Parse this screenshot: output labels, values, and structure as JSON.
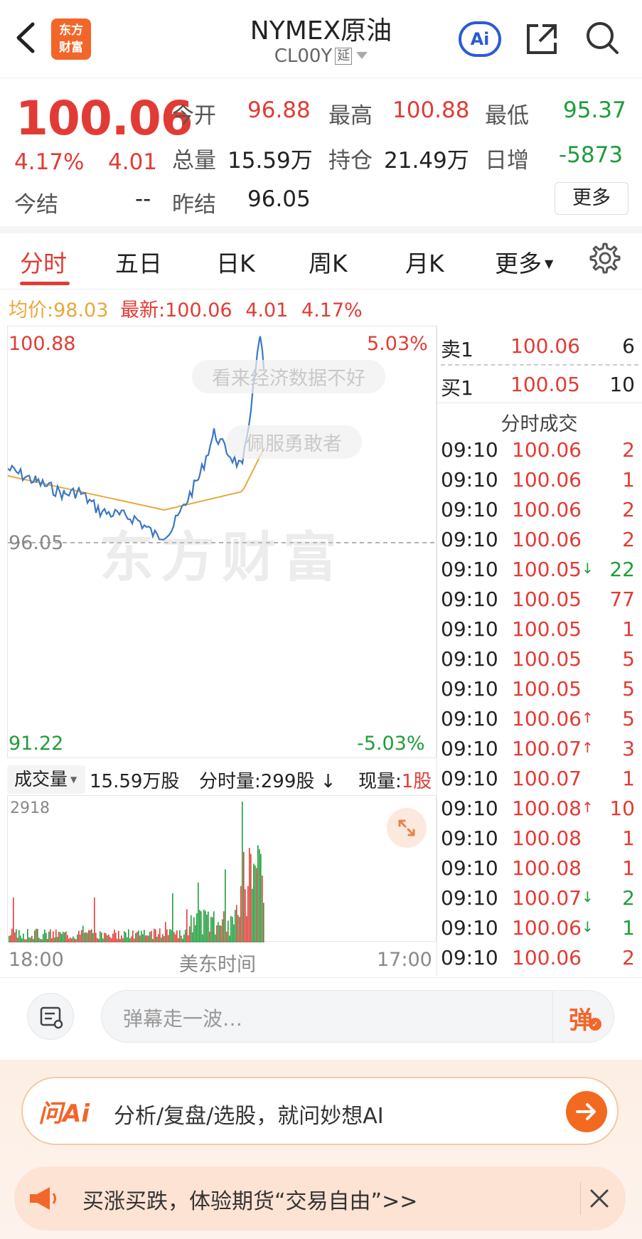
{
  "header": {
    "logo_text": "东方财富",
    "title": "NYMEX原油",
    "code": "CL00Y",
    "delay_tag": "延",
    "ai_label": "Ai"
  },
  "quote": {
    "price": "100.06",
    "change_pct": "4.17%",
    "change": "4.01",
    "open_label": "今开",
    "open": "96.88",
    "high_label": "最高",
    "high": "100.88",
    "low_label": "最低",
    "low": "95.37",
    "volume_label": "总量",
    "volume": "15.59万",
    "oi_label": "持仓",
    "oi": "21.49万",
    "daily_inc_label": "日增",
    "daily_inc": "-5873",
    "settle_label": "今结",
    "settle": "--",
    "prev_settle_label": "昨结",
    "prev_settle": "96.05",
    "more_label": "更多"
  },
  "tabs": [
    "分时",
    "五日",
    "日K",
    "周K",
    "月K",
    "更多"
  ],
  "chart_info": {
    "avg_label": "均价:",
    "avg": "98.03",
    "latest_label": "最新:",
    "latest": "100.06",
    "latest_chg": "4.01",
    "latest_pct": "4.17%"
  },
  "chart_axis": {
    "top_price": "100.88",
    "top_pct": "5.03%",
    "mid_price": "96.05",
    "bottom_price": "91.22",
    "bottom_pct": "-5.03%"
  },
  "watermarks": {
    "bullet1": "看来经济数据不好",
    "bullet2": "佩服勇敢者",
    "brand": "东方财富"
  },
  "volume_bar": {
    "label": "成交量",
    "total": "15.59万股",
    "tick_label": "分时量:",
    "tick": "299股",
    "now_label": "现量:",
    "now": "1股",
    "max": "2918",
    "start_time": "18:00",
    "tz_label": "美东时间",
    "end_time": "17:00"
  },
  "orderbook": [
    {
      "side": "卖1",
      "price": "100.06",
      "qty": "6"
    },
    {
      "side": "买1",
      "price": "100.05",
      "qty": "10"
    }
  ],
  "trades_title": "分时成交",
  "trades": [
    {
      "t": "09:10",
      "p": "100.06",
      "v": "2",
      "dir": ""
    },
    {
      "t": "09:10",
      "p": "100.06",
      "v": "1",
      "dir": ""
    },
    {
      "t": "09:10",
      "p": "100.06",
      "v": "2",
      "dir": ""
    },
    {
      "t": "09:10",
      "p": "100.06",
      "v": "2",
      "dir": ""
    },
    {
      "t": "09:10",
      "p": "100.05",
      "v": "22",
      "dir": "↓"
    },
    {
      "t": "09:10",
      "p": "100.05",
      "v": "77",
      "dir": ""
    },
    {
      "t": "09:10",
      "p": "100.05",
      "v": "1",
      "dir": ""
    },
    {
      "t": "09:10",
      "p": "100.05",
      "v": "5",
      "dir": ""
    },
    {
      "t": "09:10",
      "p": "100.05",
      "v": "5",
      "dir": ""
    },
    {
      "t": "09:10",
      "p": "100.06",
      "v": "5",
      "dir": "↑"
    },
    {
      "t": "09:10",
      "p": "100.07",
      "v": "3",
      "dir": "↑"
    },
    {
      "t": "09:10",
      "p": "100.07",
      "v": "1",
      "dir": ""
    },
    {
      "t": "09:10",
      "p": "100.08",
      "v": "10",
      "dir": "↑"
    },
    {
      "t": "09:10",
      "p": "100.08",
      "v": "1",
      "dir": ""
    },
    {
      "t": "09:10",
      "p": "100.08",
      "v": "1",
      "dir": ""
    },
    {
      "t": "09:10",
      "p": "100.07",
      "v": "2",
      "dir": "↓"
    },
    {
      "t": "09:10",
      "p": "100.06",
      "v": "1",
      "dir": "↓"
    },
    {
      "t": "09:10",
      "p": "100.06",
      "v": "2",
      "dir": ""
    }
  ],
  "danmu": {
    "placeholder": "弹幕走一波…",
    "send_label": "弹"
  },
  "ai_bar": {
    "logo": "问Ai",
    "text": "分析/复盘/选股，就问妙想AI"
  },
  "promo": {
    "text": "买涨买跌，体验期货“交易自由”>>"
  },
  "colors": {
    "up": "#e23b35",
    "down": "#1f9d3a",
    "price_line": "#3b78c4",
    "avg_line": "#e8a93c",
    "accent": "#f2662a"
  }
}
